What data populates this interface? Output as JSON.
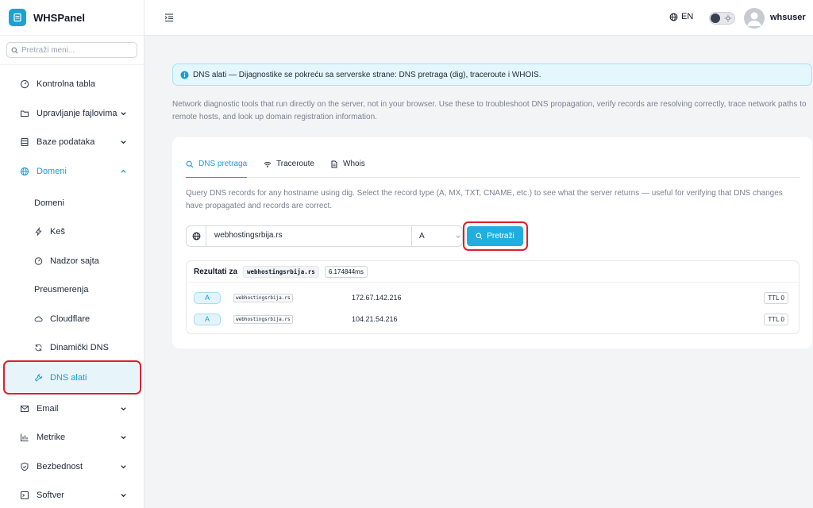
{
  "brand": {
    "name": "WHSPanel"
  },
  "sidebar": {
    "search_placeholder": "Pretraži meni...",
    "items": [
      {
        "label": "Kontrolna tabla",
        "icon": "gauge-icon"
      },
      {
        "label": "Upravljanje fajlovima",
        "icon": "folder-icon"
      },
      {
        "label": "Baze podataka",
        "icon": "database-icon"
      },
      {
        "label": "Domeni",
        "icon": "globe-icon"
      },
      {
        "label": "Email",
        "icon": "mail-icon"
      },
      {
        "label": "Metrike",
        "icon": "bar-chart-icon"
      },
      {
        "label": "Bezbednost",
        "icon": "shield-icon"
      },
      {
        "label": "Softver",
        "icon": "terminal-icon"
      }
    ],
    "sub_items": [
      {
        "label": "Domeni"
      },
      {
        "label": "Keš",
        "icon": "zap-icon"
      },
      {
        "label": "Nadzor sajta",
        "icon": "gauge-icon"
      },
      {
        "label": "Preusmerenja"
      },
      {
        "label": "Cloudflare",
        "icon": "cloud-icon"
      },
      {
        "label": "Dinamički DNS",
        "icon": "refresh-icon"
      },
      {
        "label": "DNS alati",
        "icon": "wrench-icon"
      }
    ]
  },
  "header": {
    "language": "EN",
    "username": "whsuser"
  },
  "alert": {
    "text": "DNS alati — Dijagnostike se pokreću sa serverske strane: DNS pretraga (dig), traceroute i WHOIS."
  },
  "intro": "Network diagnostic tools that run directly on the server, not in your browser. Use these to troubleshoot DNS propagation, verify records are resolving correctly, trace network paths to remote hosts, and look up domain registration information.",
  "tabs": [
    {
      "label": "DNS pretraga",
      "icon": "search-icon"
    },
    {
      "label": "Traceroute",
      "icon": "wifi-icon"
    },
    {
      "label": "Whois",
      "icon": "file-text-icon"
    }
  ],
  "lookup": {
    "description": "Query DNS records for any hostname using dig. Select the record type (A, MX, TXT, CNAME, etc.) to see what the server returns — useful for verifying that DNS changes have propagated and records are correct.",
    "hostname": "webhostingsrbija.rs",
    "record_type": "A",
    "button_label": "Pretraži"
  },
  "results": {
    "title": "Rezultati za",
    "host": "webhostingsrbija.rs",
    "time": "6.174844ms",
    "rows": [
      {
        "type": "A",
        "name": "webhostingsrbija.rs",
        "value": "172.67.142.216",
        "ttl": "TTL 0"
      },
      {
        "type": "A",
        "name": "webhostingsrbija.rs",
        "value": "104.21.54.216",
        "ttl": "TTL 0"
      }
    ]
  },
  "colors": {
    "accent": "#1a9fd0",
    "button": "#20aee0",
    "highlight": "#e11d2a",
    "alert_bg": "#e3f7fc"
  }
}
